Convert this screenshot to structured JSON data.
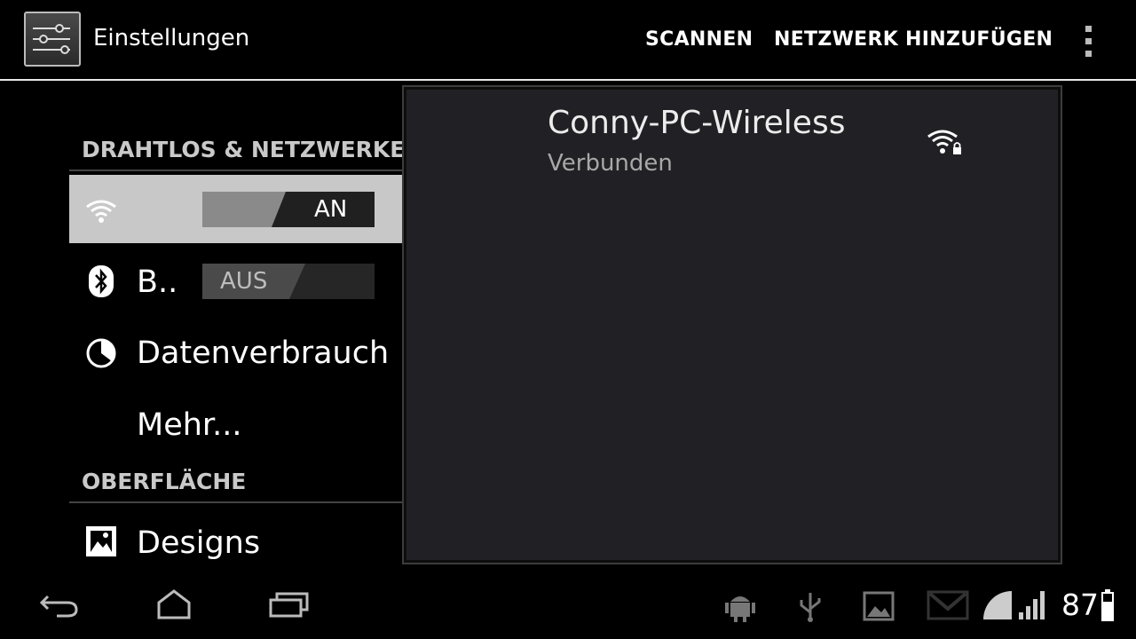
{
  "action_bar": {
    "title": "Einstellungen",
    "actions": [
      "SCANNEN",
      "NETZWERK HINZUFÜGEN"
    ]
  },
  "left_pane": {
    "wireless_header": "DRAHTLOS & NETZWERKE",
    "wifi": {
      "toggle_state": "AN",
      "on": true
    },
    "bluetooth": {
      "label": "B..",
      "toggle_state": "AUS",
      "on": false
    },
    "data_usage": {
      "label": "Datenverbrauch"
    },
    "more": {
      "label": "Mehr..."
    },
    "interface_header": "OBERFLÄCHE",
    "designs": {
      "label": "Designs"
    }
  },
  "detail": {
    "network": {
      "name": "Conny-PC-Wireless",
      "status": "Verbunden",
      "secured": true
    }
  },
  "system_bar": {
    "clock": "87",
    "notification_icons": [
      "android-debug-icon",
      "usb-icon",
      "image-icon",
      "gmail-icon"
    ]
  },
  "colors": {
    "accent": "#ffffff",
    "selected_row": "#c8c8c8",
    "detail_background": "#212125",
    "header_text": "#c9c9c9"
  }
}
